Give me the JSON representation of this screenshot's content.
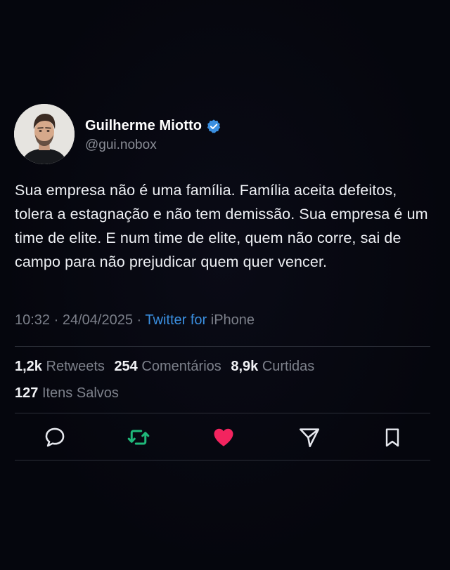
{
  "user": {
    "display_name": "Guilherme Miotto",
    "handle": "@gui.nobox",
    "verified": true
  },
  "tweet": {
    "text": "Sua empresa não é uma família. Família aceita defeitos, tolera a estagnação e não tem demissão. Sua empresa é um time de elite. E num time de elite, quem não corre, sai de campo para não prejudicar quem quer vencer.",
    "time": "10:32",
    "date": "24/04/2025",
    "separator": "·",
    "source": "Twitter for",
    "device": "iPhone"
  },
  "stats": {
    "retweets_count": "1,2k",
    "retweets_label": "Retweets",
    "comments_count": "254",
    "comments_label": "Comentários",
    "likes_count": "8,9k",
    "likes_label": "Curtidas",
    "saved_count": "127",
    "saved_label": "Itens Salvos"
  },
  "actions": {
    "reply_icon": "comment-icon",
    "retweet_icon": "retweet-icon",
    "like_icon": "heart-icon",
    "share_icon": "share-icon",
    "bookmark_icon": "bookmark-icon"
  },
  "colors": {
    "background": "#05060d",
    "verified_badge": "#3a8fe0",
    "retweet_green": "#1fb87a",
    "like_pink": "#f3245f",
    "source_link": "#3a8fe0"
  }
}
